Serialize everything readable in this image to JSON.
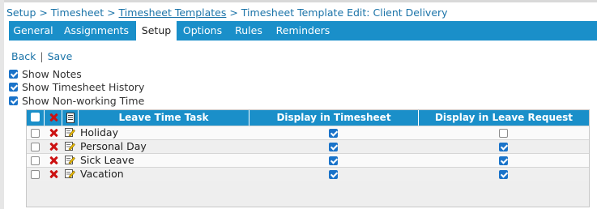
{
  "breadcrumb": {
    "part1": "Setup > Timesheet > ",
    "link": "Timesheet Templates",
    "part3": " > Timesheet Template Edit: Client Delivery"
  },
  "tabs": [
    {
      "label": "General",
      "active": false
    },
    {
      "label": "Assignments",
      "active": false
    },
    {
      "label": "Setup",
      "active": true
    },
    {
      "label": "Options",
      "active": false
    },
    {
      "label": "Rules",
      "active": false
    },
    {
      "label": "Reminders",
      "active": false
    }
  ],
  "actions": {
    "back": "Back",
    "separator": "|",
    "save": "Save"
  },
  "options": [
    {
      "label": "Show Notes",
      "checked": true
    },
    {
      "label": "Show Timesheet History",
      "checked": true
    },
    {
      "label": "Show Non-working Time",
      "checked": true
    }
  ],
  "table": {
    "headers": {
      "task": "Leave Time Task",
      "display_timesheet": "Display in Timesheet",
      "display_leave": "Display in Leave Request"
    },
    "rows": [
      {
        "task": "Holiday",
        "selected": false,
        "display_timesheet": true,
        "display_leave": false
      },
      {
        "task": "Personal Day",
        "selected": false,
        "display_timesheet": true,
        "display_leave": true
      },
      {
        "task": "Sick Leave",
        "selected": false,
        "display_timesheet": true,
        "display_leave": true
      },
      {
        "task": "Vacation",
        "selected": false,
        "display_timesheet": true,
        "display_leave": true
      }
    ]
  },
  "icons": {
    "delete": "delete-x-icon",
    "edit": "edit-note-icon",
    "doc": "document-icon"
  },
  "colors": {
    "tab_bar": "#1a8fc9",
    "link": "#1a73a8",
    "delete": "#cc1111",
    "checkbox": "#1a73c9"
  }
}
